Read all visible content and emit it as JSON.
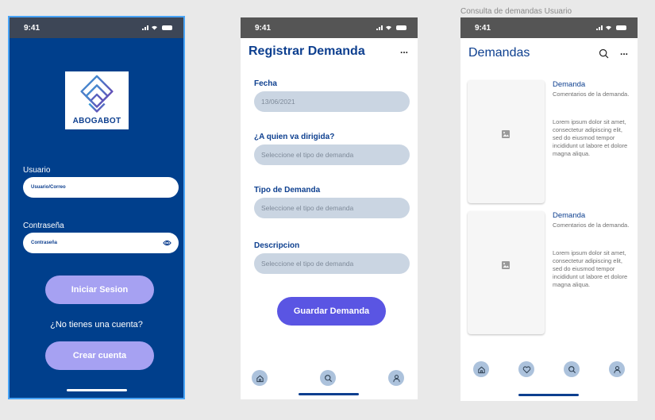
{
  "caption": "Consulta de demandas Usuario",
  "status_time": "9:41",
  "login": {
    "logo_text": "ABOGABOT",
    "user_label": "Usuario",
    "user_placeholder": "Usuario/Correo",
    "password_label": "Contraseña",
    "password_placeholder": "Contraseña",
    "login_button": "Iniciar Sesion",
    "no_account_text": "¿No tienes una cuenta?",
    "create_button": "Crear cuenta"
  },
  "register": {
    "title": "Registrar Demanda",
    "more": "...",
    "fields": [
      {
        "label": "Fecha",
        "value": "13/06/2021"
      },
      {
        "label": "¿A quien va dirigida?",
        "value": "Seleccione el tipo de demanda"
      },
      {
        "label": "Tipo de Demanda",
        "value": "Seleccione el tipo de demanda"
      },
      {
        "label": "Descripcion",
        "value": "Seleccione el tipo de demanda"
      }
    ],
    "save_button": "Guardar Demanda",
    "nav": [
      "home-icon",
      "search-icon",
      "profile-icon"
    ]
  },
  "list": {
    "title": "Demandas",
    "more": "...",
    "cards": [
      {
        "title": "Demanda",
        "comment": "Comentarios de la demanda.",
        "body": "Lorem ipsum dolor sit amet, consectetur adipiscing elit, sed do eiusmod tempor incididunt ut labore et dolore magna aliqua."
      },
      {
        "title": "Demanda",
        "comment": "Comentarios de la demanda.",
        "body": "Lorem ipsum dolor sit amet, consectetur adipiscing elit, sed do eiusmod tempor incididunt ut labore et dolore magna aliqua."
      }
    ],
    "nav": [
      "home-icon",
      "heart-icon",
      "search-icon",
      "profile-icon"
    ]
  },
  "colors": {
    "brand_blue": "#003f8c",
    "accent_purple": "#5a55e3",
    "light_purple": "#a6a1f2",
    "input_grey": "#cad5e2",
    "nav_icon_bg": "#acc2dc"
  }
}
